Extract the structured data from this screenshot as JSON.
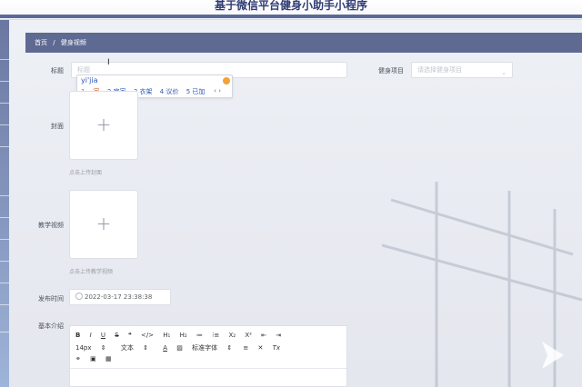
{
  "app": {
    "title": "基于微信平台健身小助手小程序"
  },
  "breadcrumb": {
    "home": "首页",
    "separator": "/",
    "current": "健身视频"
  },
  "form": {
    "title_label": "标题",
    "title_placeholder": "标题",
    "project_label": "健身项目",
    "project_placeholder": "请选择健身项目",
    "cover_label": "封面",
    "cover_hint": "点击上传封面",
    "video_label": "教学视频",
    "video_hint": "点击上传教学视频",
    "time_label": "发布时间",
    "time_value": "2022-03-17 23:38:38",
    "intro_label": "基本介绍"
  },
  "ime": {
    "input_text": "yi'jia",
    "candidates": [
      "1 一家",
      "2 宜家",
      "3 衣架",
      "4 议价",
      "5 已加"
    ],
    "more": "‹ ›"
  },
  "editor": {
    "row1": [
      "B",
      "I",
      "U",
      "S",
      "❝",
      "</>",
      "H₁",
      "H₂",
      "≔",
      "⁝≡",
      "X₂",
      "X²",
      "⇤",
      "⇥"
    ],
    "font_size": "14px",
    "text_style": "文本",
    "font_color": "A",
    "font_family": "标准字体",
    "row2_extra": [
      "≡",
      "✕",
      "Tx"
    ],
    "row3": [
      "🔗",
      "🖼",
      "🎞"
    ]
  },
  "icons": {
    "upload": "plus-icon",
    "select_arrow": "chevron-down-icon",
    "date": "clock-icon",
    "cursor": "text-cursor-icon",
    "watermark": "play-icon"
  },
  "colors": {
    "accent": "#5e6a92",
    "title": "#2f3b73",
    "ime_highlight": "#d05a2a",
    "ime_text": "#2b57b3"
  }
}
